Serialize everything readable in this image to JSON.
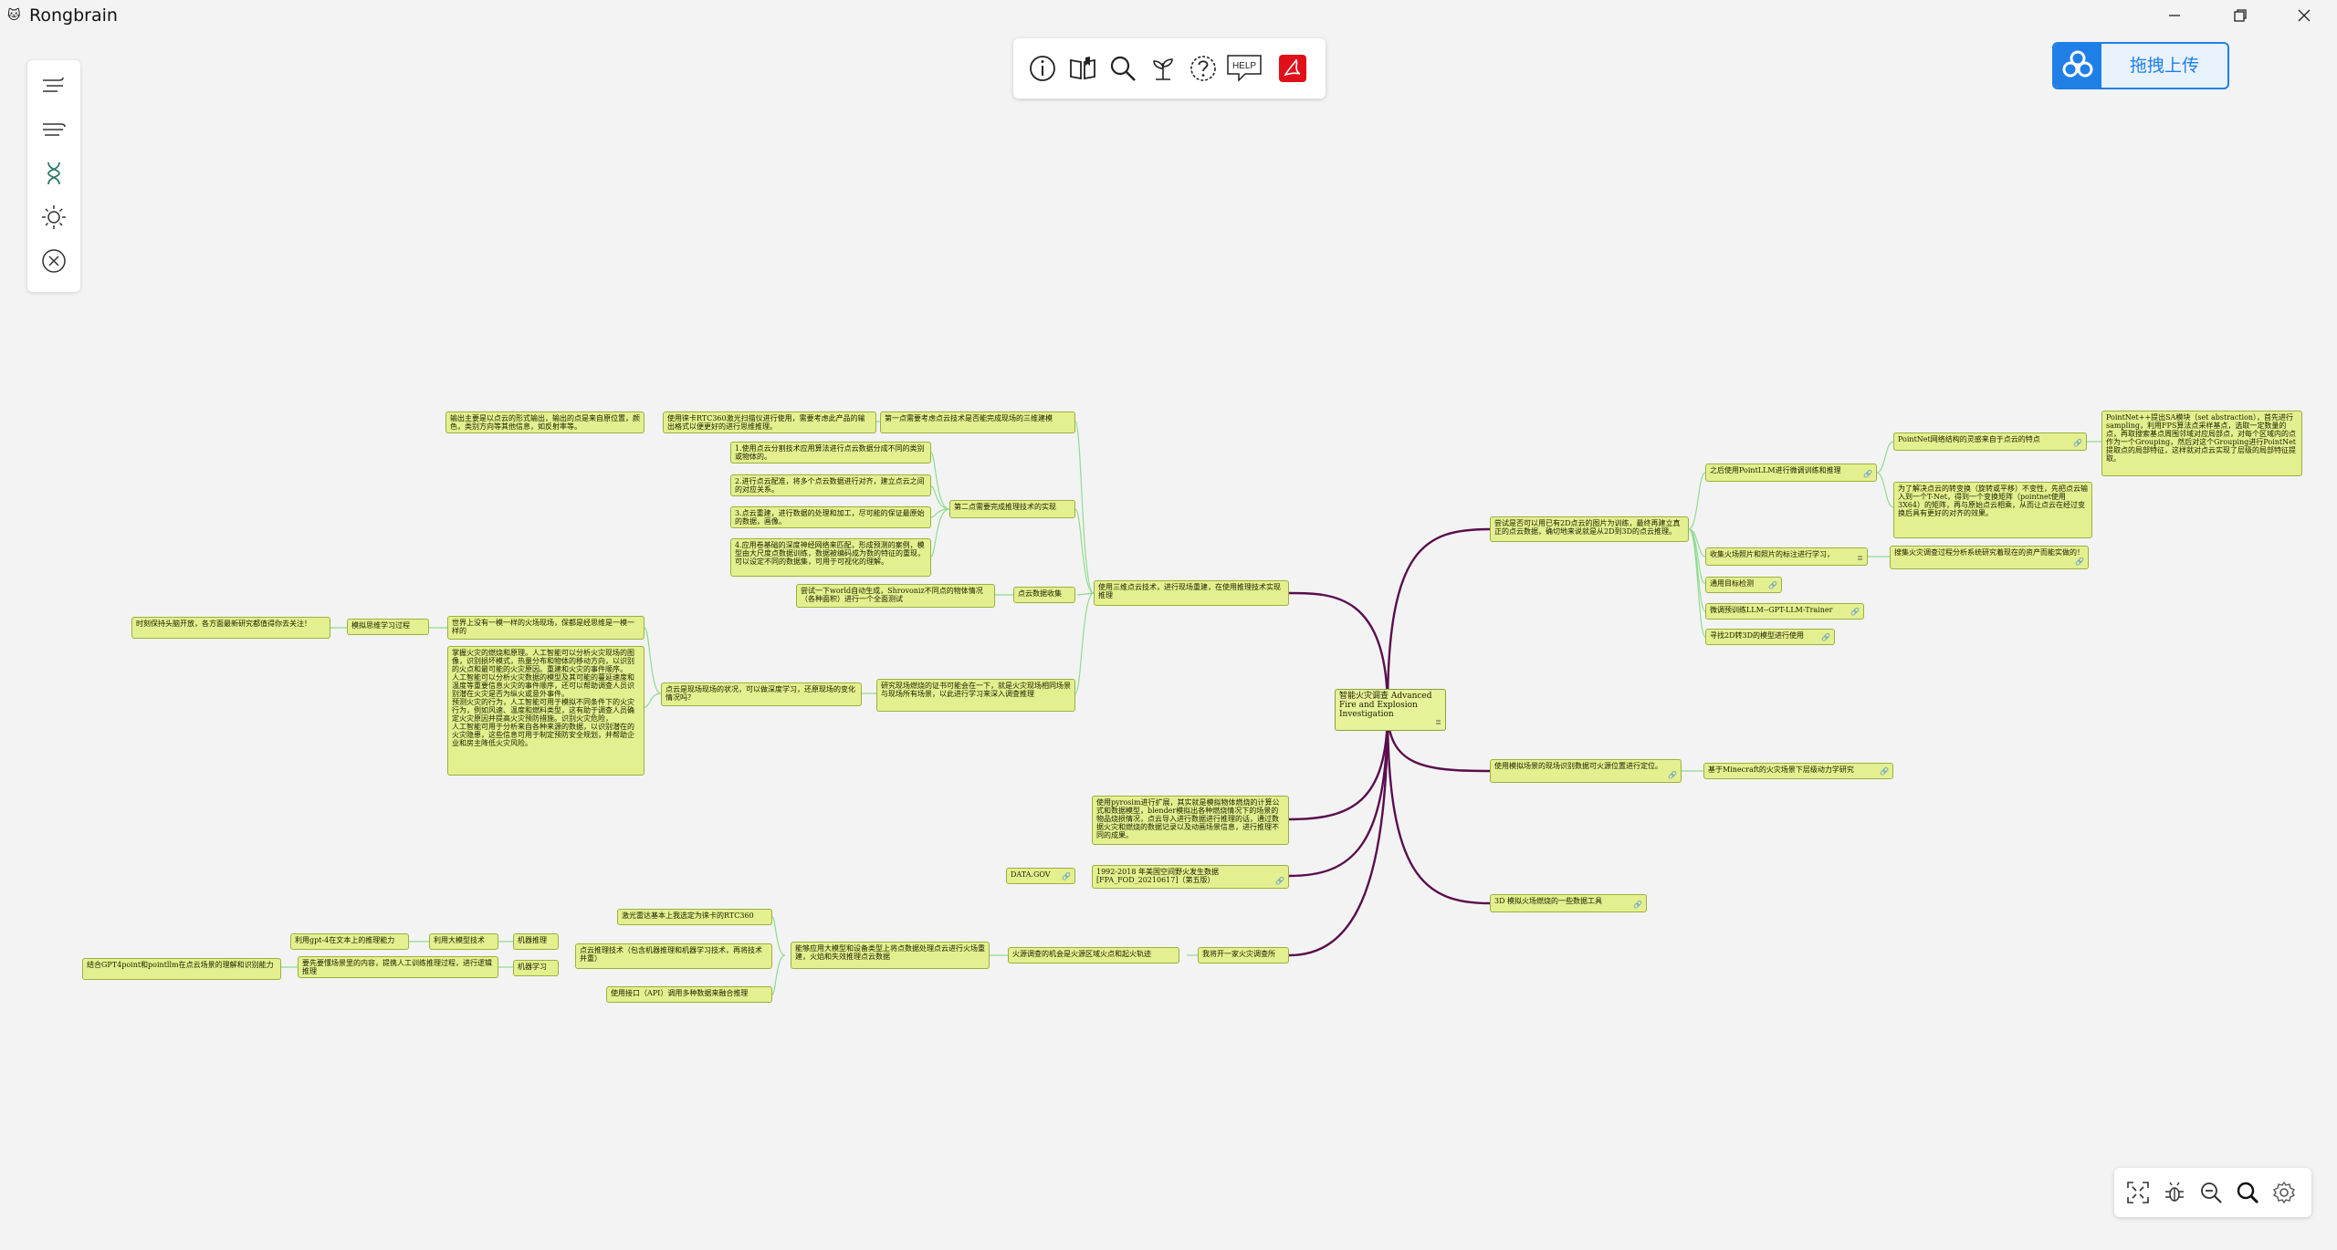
{
  "app": {
    "title": "Rongbrain",
    "logo_icon": "rongbrain-logo-icon",
    "window_controls": [
      "minimize-icon",
      "restore-icon",
      "close-icon"
    ]
  },
  "side_toolbar": {
    "tools": [
      "wind-left-icon",
      "wind-right-icon",
      "dna-icon",
      "sun-icon",
      "close-circle-icon"
    ]
  },
  "top_toolbar": {
    "tools": [
      "info-icon",
      "book-icon",
      "search-icon",
      "plant-icon",
      "question-icon",
      "help-icon",
      "pdf-icon"
    ],
    "help_label": "HELP"
  },
  "upload": {
    "label": "拖拽上传",
    "icon": "cloud-drive-icon"
  },
  "zoom_bar": {
    "tools": [
      "fit-screen-icon",
      "bug-icon",
      "zoom-out-icon",
      "zoom-in-icon",
      "settings-icon"
    ]
  },
  "colors": {
    "node_fill": "#e4f08f",
    "root_link": "#5a0e4e",
    "branch_link": "#8fdc8f",
    "accent": "#1f7fe6"
  },
  "mindmap": {
    "root": "智能火灾调查 Advanced Fire and Explosion Investigation",
    "nodes": {
      "n_seg_wrap": "输出主要是以点云的形式输出，输出的点是来自原位置，颜色，类别方向等其他信息，如反射率等。",
      "n_rtc360": "使用徕卡RTC360激光扫描仪进行使用，需要考虑此产品的输出格式以便更好的进行思维推理。",
      "n_step1": "第一点需要考虑点云技术是否能完成现场的三维建模",
      "n_ai1": "1.使用点云分割技术应用算法进行点云数据分成不同的类别或物体的。",
      "n_ai2": "2.进行点云配准，将多个点云数据进行对齐，建立点云之间的对应关系。",
      "n_ai3": "3.点云重建，进行数据的处理和加工，尽可能的保证最原始的数据，画像。",
      "n_ai4": "4.应用卷基础的深度神经网络来匹配，形成预测的案例，模型由大尺度点数据训练，数据被编码成为数的特征的重现，可以设定不同的数据集，可用于可视化的理解。",
      "n_step2": "第二点需要完成推理技术的实现",
      "n_3d_tech": "使用三维点云技术，进行现场重建，在使用推理技术实现推理",
      "n_collect": "点云数据收集",
      "n_trial": "尝试一下world自动生成，Shrovoniz不同点的物体情况（各种面积）进行一个全面测试",
      "n_opensrc": "时刻保持头脑开放，各方面最新研究都值得你去关注！",
      "n_sim_learn": "模拟思维学习过程",
      "n_world_same": "世界上没有一模一样的火场现场，保都是经思维是一模一样的",
      "n_deep_explain": "掌握火灾的燃烧和原理。人工智能可以分析火灾现场的图像，识别损坏模式，热量分布和物体的移动方向，以识别的火点和最可能的火灾原因。重建和火灾的事件顺序。\n人工智能可以分析火灾数据的模型及其可能的蔓延速度和温度等重要信息火灾的事件顺序，还可以帮助调查人员识别潜在火灾是否为纵火或意外事件。\n预测火灾的行为，人工智能可用于模拟不同条件下的火灾行为，例如风速、温度和燃料类型，这有助于调查人员确定火灾原因并提高火灾预防措施。识别火灾危险，\n人工智能可用于分析来自各种来源的数据，以识别潜在的火灾隐患，这些信息可用于制定预防安全规划，并帮助企业和房主降低火灾风险。",
      "n_pointcloud_deep": "点云是现场现场的状况，可以做深度学习，还原现场的变化情况吗？",
      "n_research": "研究现场燃烧的证书可能会在一下，就是火灾现场相同场景与现场所有场景，以此进行学习来深入调查推理",
      "n_attempt": "尝试是否可以用已有2D点云的图片为训练，最终再建立真正的点云数据，确切地来说就是从2D到3D的点云推理。",
      "n_pointllm": "之后使用PointLLM进行微调训练和推理",
      "n_pointnet": "PointNet网络结构的灵感来自于点云的特点",
      "n_pn_expl": "PointNet++提出SA模块（set abstraction），首先进行sampling，利用FPS算法点采样基点，选取一定数量的点，再取搜索基点周围邻域对应局部点，对每个区域内的点作为一个Grouping，然后对这个Grouping进行PointNet提取点的局部特征，这样就对点云实现了层级的局部特征提取。",
      "n_tnet": "为了解决点云的转变换（旋转或平移）不变性，先把点云输入到一个T-Net，得到一个变换矩阵（pointnet使用3X64）的矩阵，再与原始点云相乘，从而让点云在经过变换后具有更好的对齐的效果。",
      "n_firepics": "收集火场照片和照片的标注进行学习，",
      "n_pics_note": "搜集火灾调查过程分析系统研究着现在的资产而能实做的！",
      "n_target_detect": "通用目标检测",
      "n_finetune": "微调预训练LLM--GPT-LLM-Trainer",
      "n_2d3d_model": "寻找2D转3D的模型进行使用",
      "n_simulate": "使用模拟场景的现场识别数据可火源位置进行定位。",
      "n_minecraft": "基于Minecraft的火灾场景下层级动力学研究",
      "n_3d_tools": "3D 模拟火场燃烧的一些数据工具",
      "n_pyrosim": "使用pyrosim进行扩展，其实就是模拟物体燃烧的计算公式和数据模型，blender模拟出各种燃烧情况下的场景的物品烧损情况，点云导入进行数据进行推理的话，通过数据火灾和燃烧的数据记录以及动画场景信息，进行推理不同的成果。",
      "n_datagov": "DATA.GOV",
      "n_fpa": "1992-2018 年美国空间野火发生数据[FPA_FOD_20210617]（第五版）",
      "n_laser": "激光雷达基本上我选定为徕卡的RTC360",
      "n_gpt4_infer": "利用gpt-4在文本上的推理能力",
      "n_llm_tech": "利用大模型技术",
      "n_ml_infer": "机器推理",
      "n_reasoning": "点云推理技术（包含机器推理和机器学习技术，再将技术并重）",
      "n_train_reason": "要先要懂场景里的内容，提携人工训练推理过程，进行逻辑推理",
      "n_ml": "机器学习",
      "n_gpt4_pointllm": "结合GPT4point和pointllm在点云场景的理解和识别能力",
      "n_api": "使用接口（API）调用多种数据来融合推理",
      "n_big_model": "能够应用大模型和设备类型上将点数据处理点云进行火场重建，火焰和失效推理点云数据",
      "n_fire_path": "火源调查的机会是火源区域火点和起火轨迹",
      "n_new_method": "我将开一家火灾调查所"
    }
  }
}
